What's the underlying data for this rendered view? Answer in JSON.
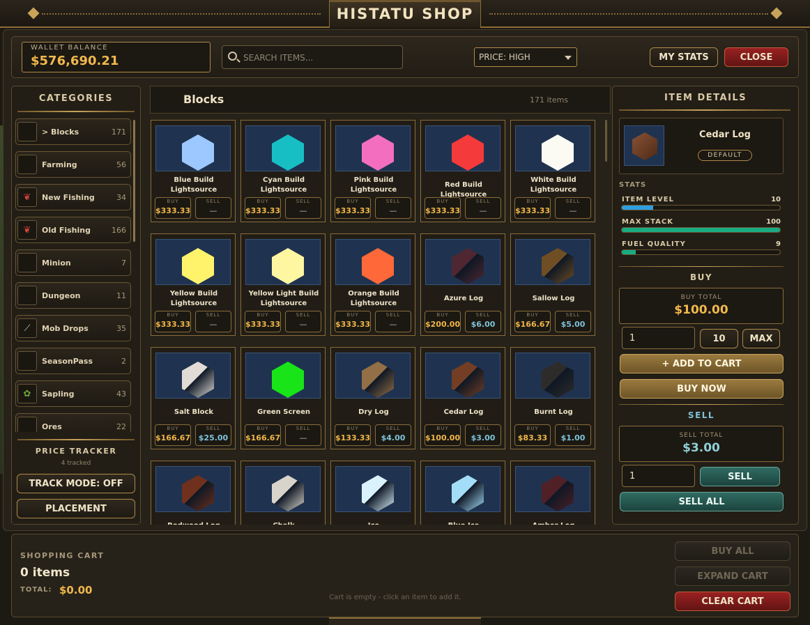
{
  "title": "HISTATU SHOP",
  "wallet": {
    "label": "WALLET BALANCE",
    "value": "$576,690.21"
  },
  "search": {
    "placeholder": "SEARCH ITEMS..."
  },
  "price_filter": {
    "value": "PRICE: HIGH"
  },
  "header_buttons": {
    "my_stats": "MY STATS",
    "close": "CLOSE"
  },
  "categories": {
    "heading": "CATEGORIES",
    "items": [
      {
        "label": "> Blocks",
        "count": "171",
        "icon": "empty"
      },
      {
        "label": "Farming",
        "count": "56",
        "icon": "empty"
      },
      {
        "label": "New Fishing",
        "count": "34",
        "icon": "red-fish-icon"
      },
      {
        "label": "Old Fishing",
        "count": "166",
        "icon": "red-fish-icon"
      },
      {
        "label": "Minion",
        "count": "7",
        "icon": "empty"
      },
      {
        "label": "Dungeon",
        "count": "11",
        "icon": "empty"
      },
      {
        "label": "Mob Drops",
        "count": "35",
        "icon": "bone-icon"
      },
      {
        "label": "SeasonPass",
        "count": "2",
        "icon": "empty"
      },
      {
        "label": "Sapling",
        "count": "43",
        "icon": "sapling-icon"
      },
      {
        "label": "Ores",
        "count": "22",
        "icon": "empty"
      }
    ]
  },
  "price_tracker": {
    "heading": "PRICE TRACKER",
    "tracked": "4 tracked",
    "track_mode": "TRACK MODE: OFF",
    "placement": "PLACEMENT"
  },
  "grid": {
    "title": "Blocks",
    "count": "171 items",
    "buy_tag": "BUY",
    "sell_tag": "SELL",
    "items": [
      {
        "name": "Blue Build Lightsource",
        "buy": "$333.33",
        "sell": "—",
        "color": "#9cc8ff",
        "shape": "hex"
      },
      {
        "name": "Cyan Build Lightsource",
        "buy": "$333.33",
        "sell": "—",
        "color": "#17bfc4",
        "shape": "hex"
      },
      {
        "name": "Pink Build Lightsource",
        "buy": "$333.33",
        "sell": "—",
        "color": "#f36ebf",
        "shape": "hex"
      },
      {
        "name": "Red Build Lightsource",
        "buy": "$333.33",
        "sell": "—",
        "color": "#f43a3a",
        "shape": "hex"
      },
      {
        "name": "White Build Lightsource",
        "buy": "$333.33",
        "sell": "—",
        "color": "#fbfbf4",
        "shape": "hex"
      },
      {
        "name": "Yellow Build Lightsource",
        "buy": "$333.33",
        "sell": "—",
        "color": "#fff36b",
        "shape": "hex"
      },
      {
        "name": "Yellow Light Build Lightsource",
        "buy": "$333.33",
        "sell": "—",
        "color": "#fff6a2",
        "shape": "hex"
      },
      {
        "name": "Orange Build Lightsource",
        "buy": "$333.33",
        "sell": "—",
        "color": "#ff6838",
        "shape": "hex"
      },
      {
        "name": "Azure Log",
        "buy": "$200.00",
        "sell": "$6.00",
        "color": "#4a2530",
        "shape": "cube"
      },
      {
        "name": "Sallow Log",
        "buy": "$166.67",
        "sell": "$5.00",
        "color": "#6b4a22",
        "shape": "cube"
      },
      {
        "name": "Salt Block",
        "buy": "$166.67",
        "sell": "$25.00",
        "color": "#d6d2cc",
        "shape": "cube"
      },
      {
        "name": "Green Screen",
        "buy": "$166.67",
        "sell": "—",
        "color": "#18e418",
        "shape": "hex"
      },
      {
        "name": "Dry Log",
        "buy": "$133.33",
        "sell": "$4.00",
        "color": "#8c6a44",
        "shape": "cube"
      },
      {
        "name": "Cedar Log",
        "buy": "$100.00",
        "sell": "$3.00",
        "color": "#6e3b22",
        "shape": "cube"
      },
      {
        "name": "Burnt Log",
        "buy": "$83.33",
        "sell": "$1.00",
        "color": "#2b2a28",
        "shape": "cube"
      },
      {
        "name": "Redwood Log",
        "buy": "",
        "sell": "",
        "color": "#6a2e1c",
        "shape": "cube"
      },
      {
        "name": "Chalk",
        "buy": "",
        "sell": "",
        "color": "#cfcac1",
        "shape": "cube"
      },
      {
        "name": "Ice",
        "buy": "",
        "sell": "",
        "color": "#cfe6f0",
        "shape": "cube"
      },
      {
        "name": "Blue Ice",
        "buy": "",
        "sell": "",
        "color": "#9cd2ec",
        "shape": "cube"
      },
      {
        "name": "Amber Log",
        "buy": "",
        "sell": "",
        "color": "#4b1e24",
        "shape": "cube"
      }
    ]
  },
  "details": {
    "heading": "ITEM DETAILS",
    "item_name": "Cedar Log",
    "badge": "DEFAULT",
    "stats_label": "STATS",
    "stats": [
      {
        "label": "ITEM LEVEL",
        "value": "10",
        "fill": 0.2,
        "color": "#2f9fe0"
      },
      {
        "label": "MAX STACK",
        "value": "100",
        "fill": 1.0,
        "color": "#19ab82"
      },
      {
        "label": "FUEL QUALITY",
        "value": "9",
        "fill": 0.09,
        "color": "#19ab82"
      }
    ],
    "buy": {
      "heading": "BUY",
      "total_label": "BUY TOTAL",
      "total": "$100.00",
      "qty": "1",
      "ten": "10",
      "max": "MAX",
      "add_to_cart": "+ ADD TO CART",
      "buy_now": "BUY NOW"
    },
    "sell": {
      "heading": "SELL",
      "total_label": "SELL TOTAL",
      "total": "$3.00",
      "qty": "1",
      "sell": "SELL",
      "sell_all": "SELL ALL"
    }
  },
  "cart": {
    "heading": "SHOPPING CART",
    "items": "0 items",
    "total_label": "TOTAL:",
    "total": "$0.00",
    "empty_msg": "Cart is empty - click an item to add it.",
    "buy_all": "BUY ALL",
    "expand": "EXPAND CART",
    "clear": "CLEAR CART"
  },
  "colors": {
    "gold": "#f1b84c",
    "teal": "#7ec2d8",
    "accent": "#c9a35a"
  }
}
